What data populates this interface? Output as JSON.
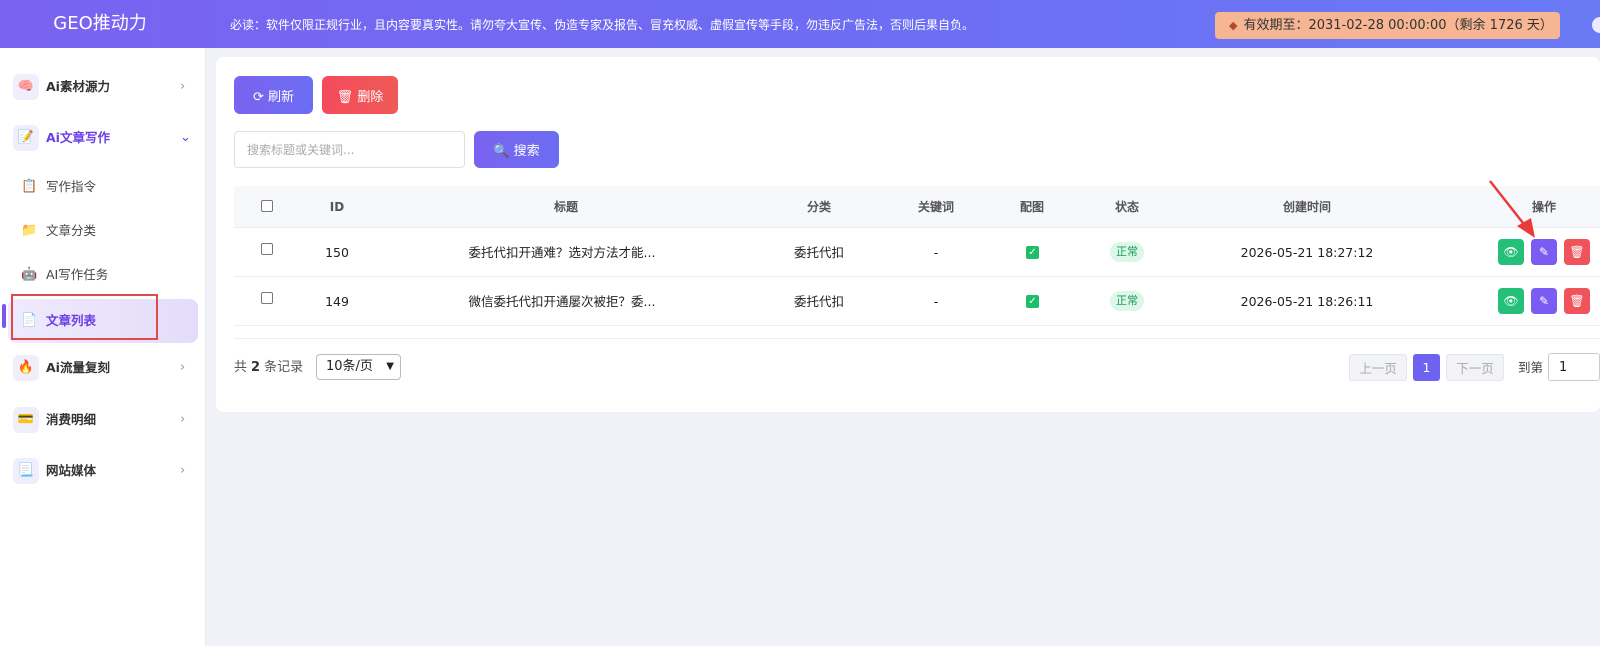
{
  "header": {
    "logo": "GEO推动力",
    "notice": "必读：软件仅限正规行业，且内容要真实性。请勿夸大宣传、伪造专家及报告、冒充权威、虚假宣传等手段，勿违反广告法，否则后果自负。",
    "expiry": "有效期至：2031-02-28 00:00:00（剩余 1726 天）"
  },
  "sidebar": {
    "items": [
      {
        "label": "Ai素材源力",
        "icon": "brain-icon"
      },
      {
        "label": "Ai文章写作",
        "icon": "write-icon"
      },
      {
        "label": "写作指令",
        "icon": "memo-icon"
      },
      {
        "label": "文章分类",
        "icon": "folder-icon"
      },
      {
        "label": "AI写作任务",
        "icon": "robot-icon"
      },
      {
        "label": "文章列表",
        "icon": "page-icon"
      },
      {
        "label": "Ai流量复刻",
        "icon": "fire-icon"
      },
      {
        "label": "消费明细",
        "icon": "card-icon"
      },
      {
        "label": "网站媒体",
        "icon": "doc-icon"
      }
    ]
  },
  "toolbar": {
    "refresh_label": "刷新",
    "delete_label": "删除",
    "search_placeholder": "搜索标题或关键词...",
    "search_label": "搜索"
  },
  "table": {
    "headers": [
      "ID",
      "标题",
      "分类",
      "关键词",
      "配图",
      "状态",
      "创建时间",
      "操作"
    ],
    "rows": [
      {
        "id": "150",
        "title": "委托代扣开通难？选对方法才能...",
        "category": "委托代扣",
        "keywords": "-",
        "status": "正常",
        "created": "2026-05-21 18:27:12"
      },
      {
        "id": "149",
        "title": "微信委托代扣开通屡次被拒？委...",
        "category": "委托代扣",
        "keywords": "-",
        "status": "正常",
        "created": "2026-05-21 18:26:11"
      }
    ]
  },
  "pagination": {
    "total_prefix": "共",
    "total": "2",
    "total_suffix": "条记录",
    "page_size": "10条/页",
    "prev": "上一页",
    "current": "1",
    "next": "下一页",
    "goto_label": "到第",
    "goto_value": "1"
  },
  "colors": {
    "accent": "#7b5cf2",
    "danger": "#f0535a",
    "success": "#24c07a"
  }
}
